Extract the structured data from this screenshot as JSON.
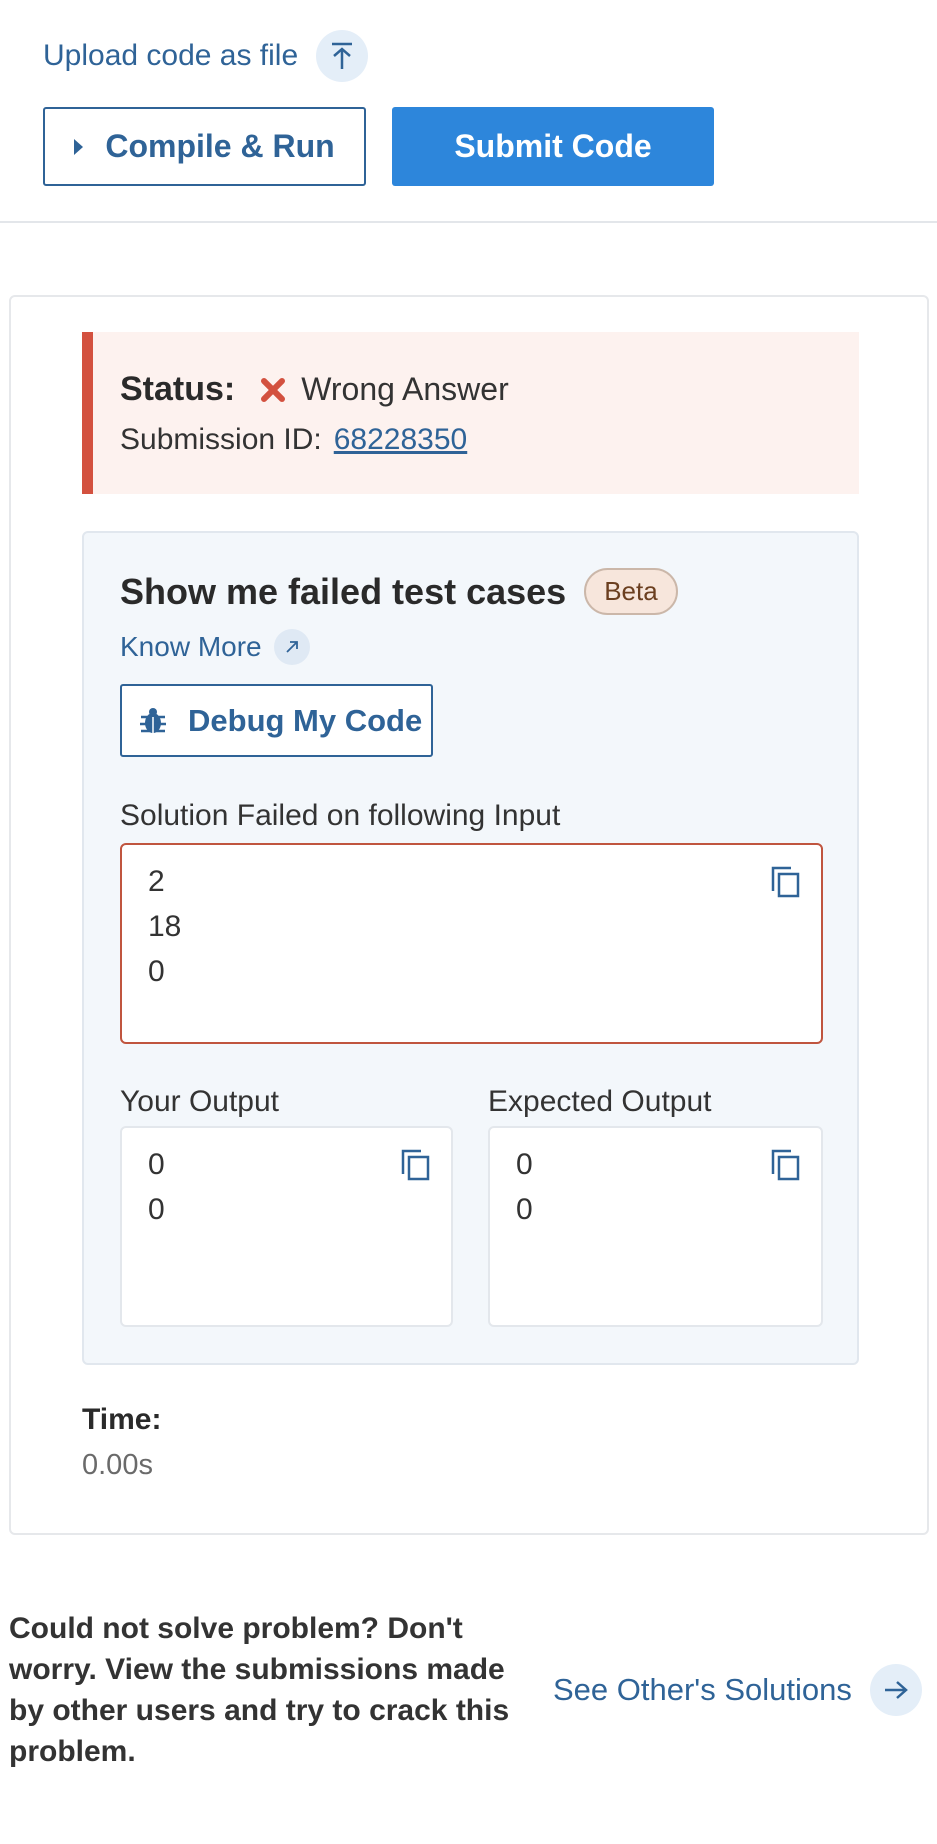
{
  "editor": {
    "upload_label": "Upload code as file",
    "compile_run_label": "Compile & Run",
    "submit_label": "Submit Code"
  },
  "result": {
    "status_label": "Status:",
    "status_value": "Wrong Answer",
    "submission_label": "Submission ID:",
    "submission_id": "68228350",
    "failed_panel": {
      "title": "Show me failed test cases",
      "beta_badge": "Beta",
      "know_more": "Know More",
      "debug_label": "Debug My Code",
      "input_label": "Solution Failed on following Input",
      "input_lines": [
        "2",
        "18",
        "0"
      ],
      "your_output_label": "Your Output",
      "your_output_lines": [
        "0",
        "0"
      ],
      "expected_output_label": "Expected Output",
      "expected_output_lines": [
        "0",
        "0"
      ]
    },
    "time_label": "Time:",
    "time_value": "0.00s"
  },
  "footer": {
    "help_text": "Could not solve problem? Don't worry. View the submissions made by other users and try to crack this problem.",
    "see_solutions_label": "See Other's Solutions"
  },
  "colors": {
    "primary": "#2d86db",
    "link": "#2f6397",
    "error": "#d3513f",
    "error_bg": "#fdf2ef"
  }
}
